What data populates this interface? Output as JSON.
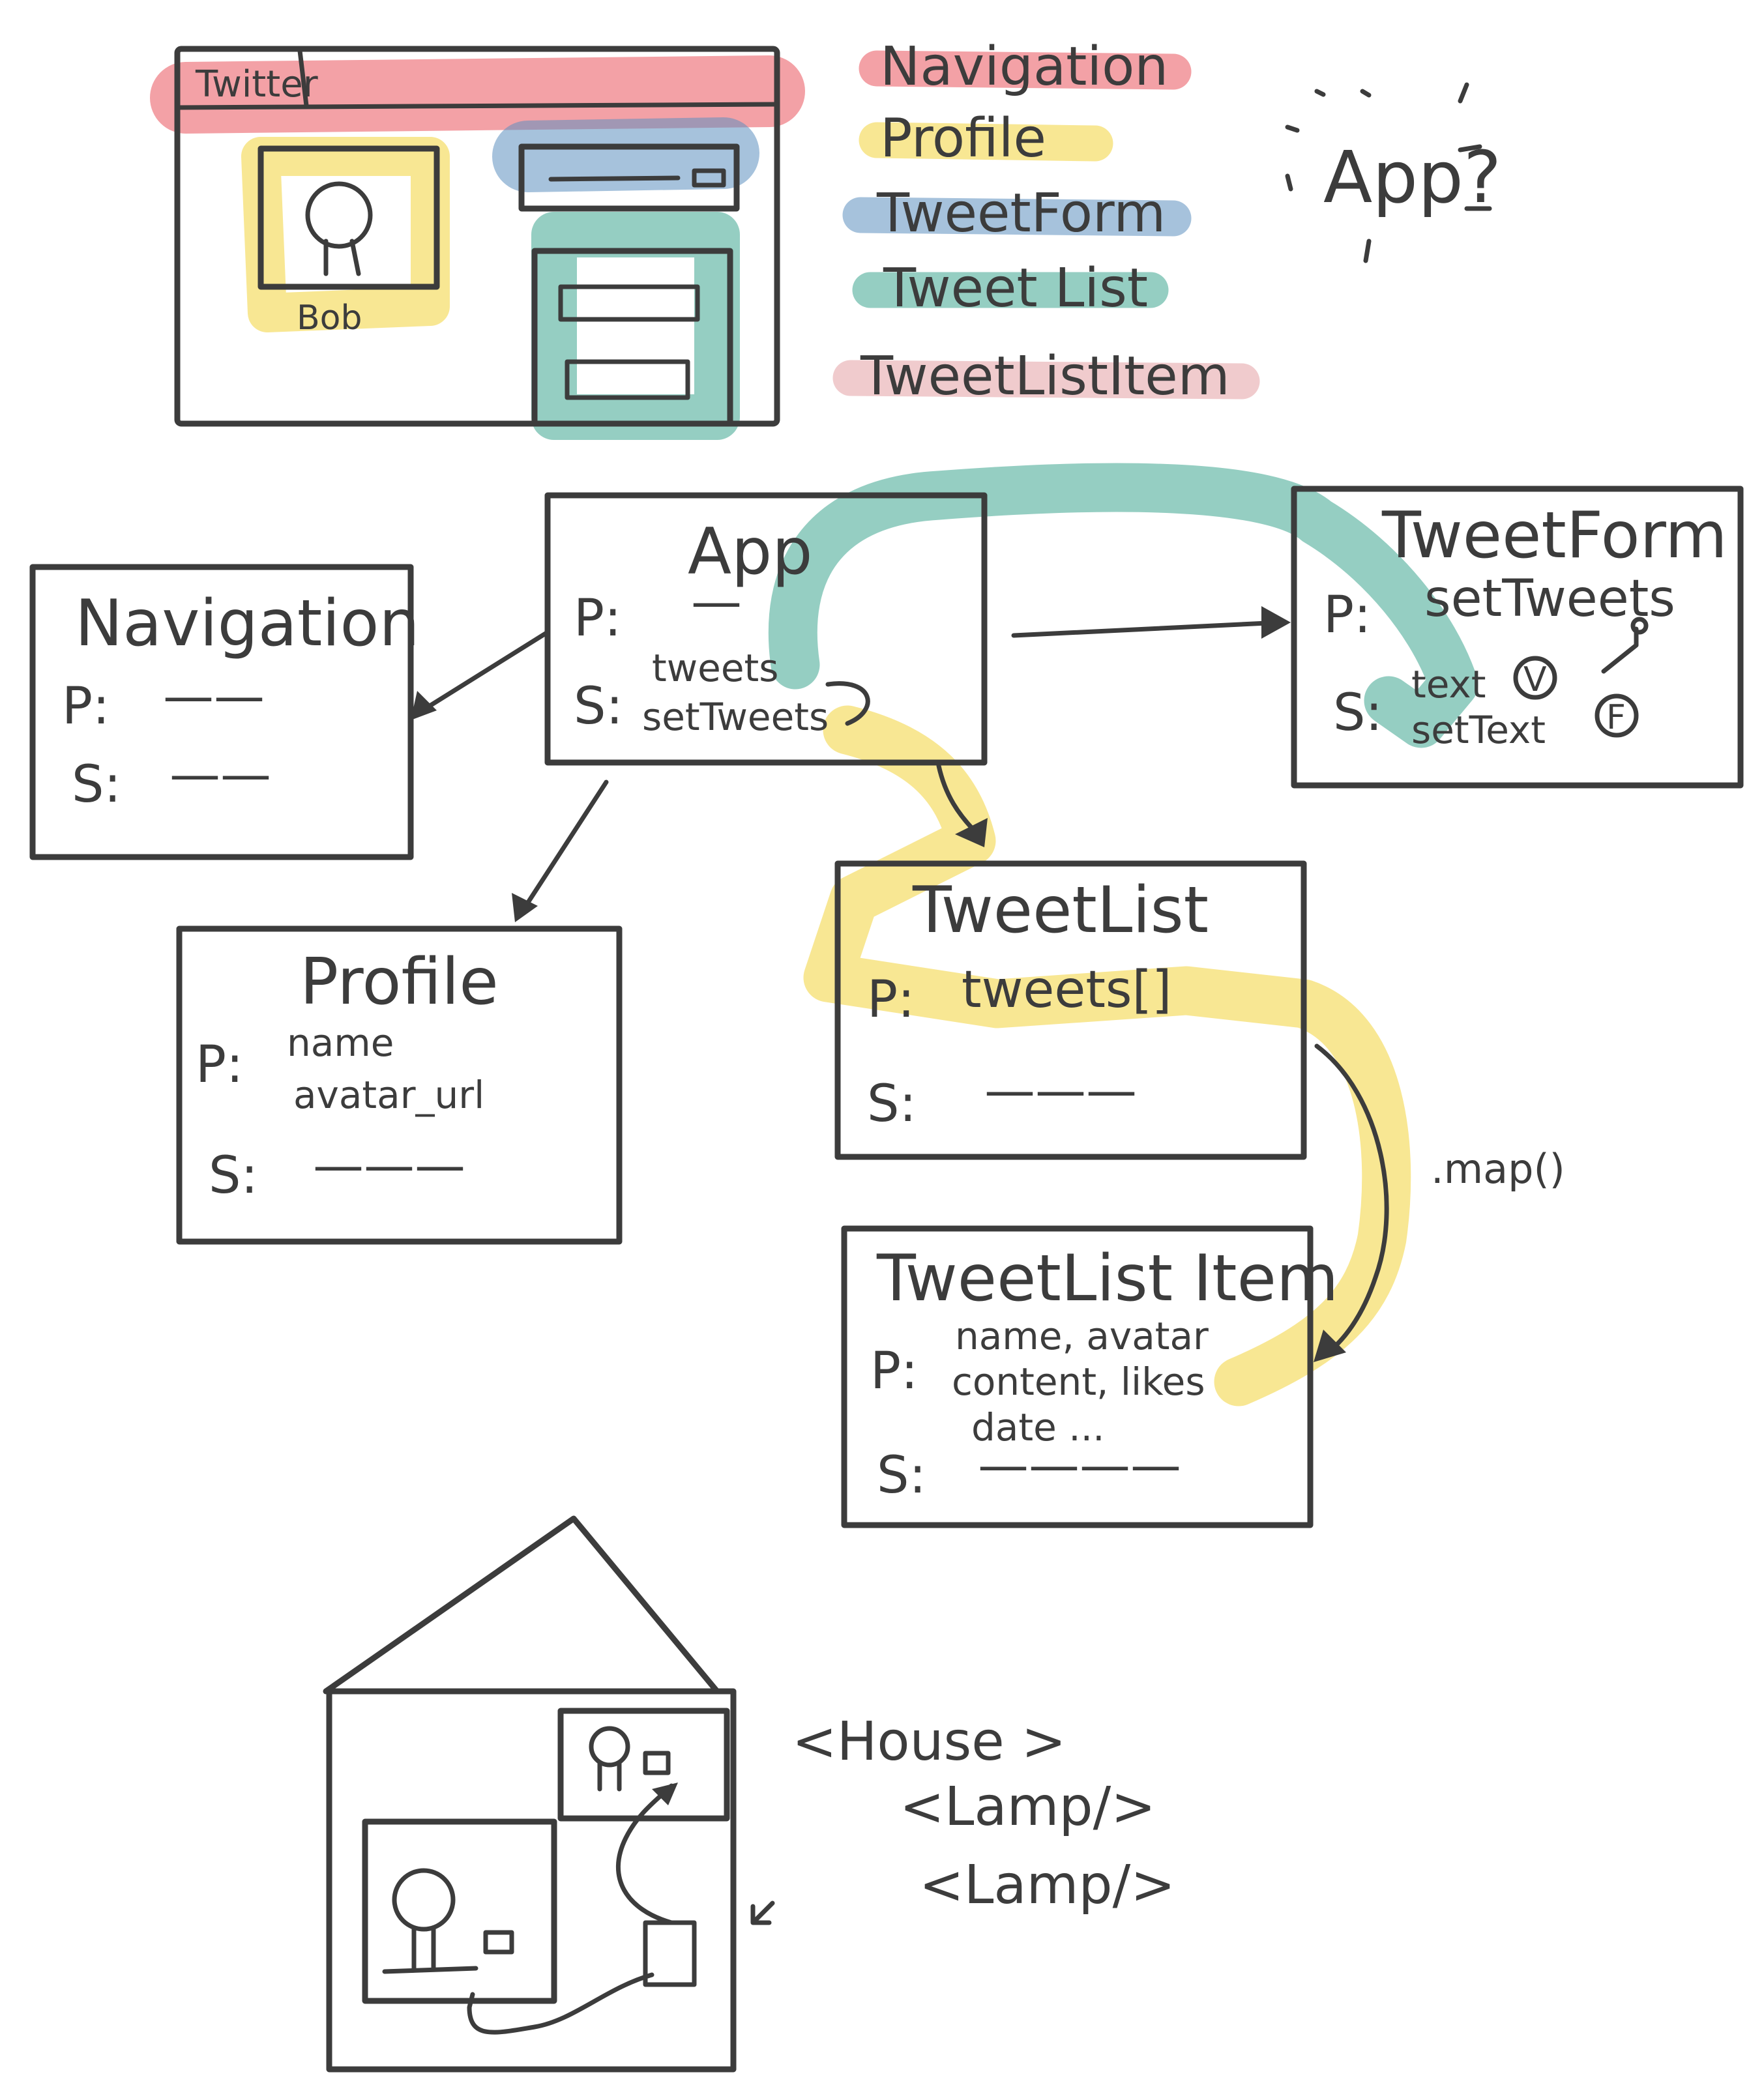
{
  "colors": {
    "ink": "#3c3c3c",
    "navigation": "#e9545c",
    "profile": "#f2d33a",
    "tweet_form": "#5c8fbf",
    "tweet_list": "#3ea58f",
    "tweet_list_item": "#e4a0a4"
  },
  "wireframe": {
    "title": "Twitter",
    "username": "Bob"
  },
  "legend": [
    "Navigation",
    "Profile",
    "TweetForm",
    "Tweet List",
    "TweetListItem"
  ],
  "question": "App?",
  "components": {
    "app": {
      "title": "App",
      "p_label": "P:",
      "p_value": "—",
      "s_label": "S:",
      "s_values": [
        "tweets",
        "setTweets"
      ]
    },
    "navigation": {
      "title": "Navigation",
      "p_label": "P:",
      "p_value": "——",
      "s_label": "S:",
      "s_value": "——"
    },
    "tweet_form": {
      "title": "TweetForm",
      "p_label": "P:",
      "p_value": "setTweets",
      "s_label": "S:",
      "s_values": [
        "text",
        "setText"
      ]
    },
    "profile": {
      "title": "Profile",
      "p_label": "P:",
      "p_values": [
        "name",
        "avatar_url"
      ],
      "s_label": "S:",
      "s_value": "———"
    },
    "tweet_list": {
      "title": "TweetList",
      "p_label": "P:",
      "p_value": "tweets[]",
      "s_label": "S:",
      "s_value": "———"
    },
    "tweet_list_item": {
      "title": "TweetList Item",
      "p_label": "P:",
      "p_values": [
        "name, avatar",
        "content, likes",
        "date ..."
      ],
      "s_label": "S:",
      "s_value": "————"
    }
  },
  "map_label": ".map()",
  "badges": {
    "v": "V",
    "f": "F"
  },
  "house_code": [
    "<House >",
    "<Lamp/>",
    "<Lamp/>"
  ]
}
